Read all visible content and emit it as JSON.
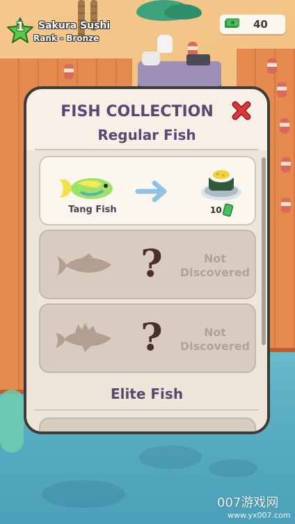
{
  "hud": {
    "level": "1",
    "restaurant_name": "Sakura Sushi",
    "rank": "Rank - Bronze",
    "money": "40",
    "money_icon": "cash-stack-icon",
    "level_icon": "green-star-icon"
  },
  "modal": {
    "title": "FISH COLLECTION",
    "close_icon": "red-x-icon",
    "sections": [
      {
        "title": "Regular Fish",
        "cards": [
          {
            "state": "discovered",
            "fish_name": "Tang Fish",
            "fish_icon": "tang-fish-icon",
            "arrow_icon": "arrow-right-icon",
            "dish_icon": "sushi-roll-icon",
            "reward": "10",
            "reward_icon": "cash-icon"
          },
          {
            "state": "locked",
            "silhouette_icon": "fish-silhouette-icon",
            "unknown": "?",
            "status": "Not Discovered"
          },
          {
            "state": "locked",
            "silhouette_icon": "spiny-fish-silhouette-icon",
            "unknown": "?",
            "status": "Not Discovered"
          }
        ]
      },
      {
        "title": "Elite Fish"
      }
    ]
  },
  "colors": {
    "title": "#5b4872",
    "close": "#e0363a",
    "arrow": "#8fc3e6",
    "locked_card": "#d8ccc0",
    "silhouette": "#b39e92",
    "level_star": "#58c94a"
  },
  "watermark": {
    "brand": "007游戏网",
    "url": "www.yx007.com"
  }
}
